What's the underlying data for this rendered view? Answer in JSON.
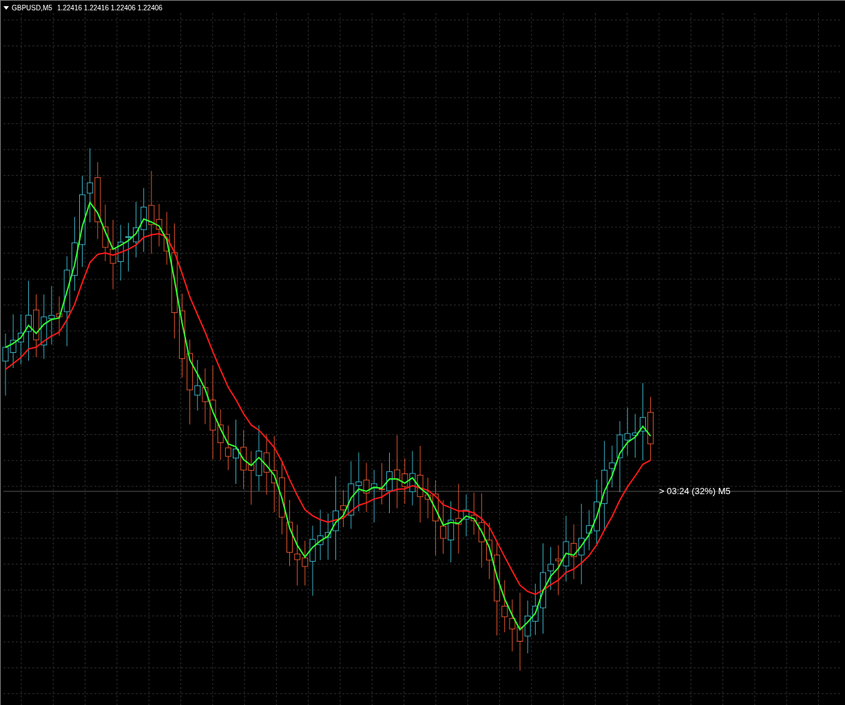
{
  "chart_header": {
    "symbol": "GBPUSD,M5",
    "prices": "1.22416 1.22416 1.22406 1.22406"
  },
  "bar_timer": {
    "text": "> 03:24 (32%) M5"
  }
}
